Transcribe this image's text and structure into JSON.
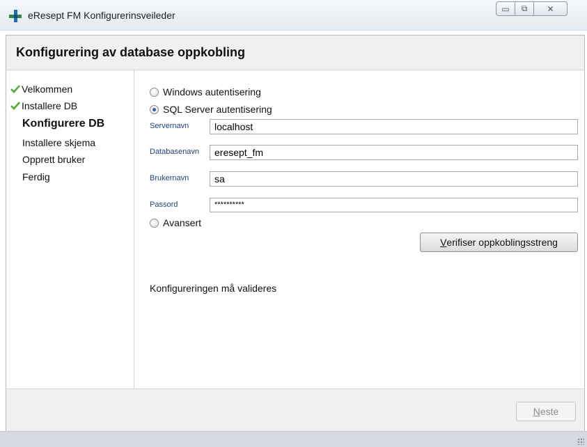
{
  "window": {
    "title": "eResept FM Konfigurerinsveileder",
    "min_glyph": "▭",
    "max_glyph": "⧉",
    "close_glyph": "✕"
  },
  "header": {
    "title": "Konfigurering av database oppkobling"
  },
  "sidebar": {
    "steps": [
      {
        "label": "Velkommen",
        "state": "done"
      },
      {
        "label": "Installere DB",
        "state": "done"
      },
      {
        "label": "Konfigurere DB",
        "state": "current"
      },
      {
        "label": "Installere skjema",
        "state": "pending"
      },
      {
        "label": "Opprett bruker",
        "state": "pending"
      },
      {
        "label": "Ferdig",
        "state": "pending"
      }
    ]
  },
  "auth": {
    "windows_label": "Windows autentisering",
    "sql_label": "SQL Server autentisering",
    "selected": "sql"
  },
  "fields": {
    "server": {
      "label": "Servernavn",
      "value": "localhost"
    },
    "database": {
      "label": "Databasenavn",
      "value": "eresept_fm"
    },
    "user": {
      "label": "Brukernavn",
      "value": "sa"
    },
    "password": {
      "label": "Passord",
      "value": "**********"
    }
  },
  "advanced_label": "Avansert",
  "verify_button": {
    "accel": "V",
    "rest": "erifiser oppkoblingsstreng"
  },
  "status_text": "Konfigureringen må valideres",
  "next_button": {
    "accel": "N",
    "rest": "este",
    "enabled": false
  },
  "colors": {
    "check": "#4caf2a",
    "label_blue": "#1f3f8a",
    "header_bg": "#f0f0f0"
  }
}
